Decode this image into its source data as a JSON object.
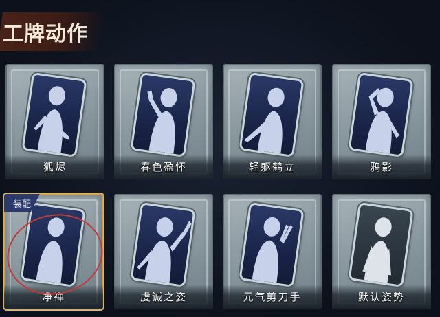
{
  "header": {
    "title": "工牌动作"
  },
  "cards": [
    {
      "label": "狐烬",
      "pose": "hand-forward"
    },
    {
      "label": "春色盈怀",
      "pose": "hand-up"
    },
    {
      "label": "轻躯鹤立",
      "pose": "arm-extended"
    },
    {
      "label": "鸦影",
      "pose": "hand-on-head"
    },
    {
      "label": "净禅",
      "pose": "hands-together",
      "equipped": true,
      "badge": "装配"
    },
    {
      "label": "虔诚之姿",
      "pose": "arm-raised"
    },
    {
      "label": "元气剪刀手",
      "pose": "peace-sign"
    },
    {
      "label": "默认姿势",
      "pose": "default"
    }
  ],
  "colors": {
    "equipped_border": "#d8b46a",
    "badge_bg": "#2b3a6a",
    "annotation": "#c23a3a"
  }
}
